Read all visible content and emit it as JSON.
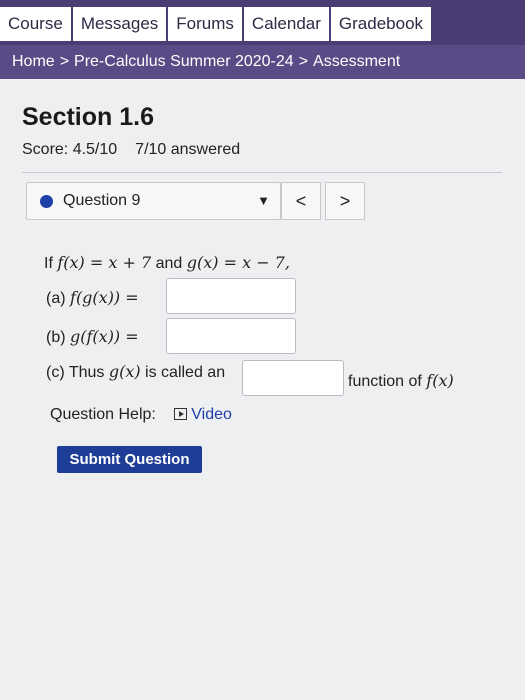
{
  "nav": {
    "tabs": [
      "Course",
      "Messages",
      "Forums",
      "Calendar",
      "Gradebook"
    ]
  },
  "breadcrumb": {
    "home": "Home",
    "separator": ">",
    "course": "Pre-Calculus Summer 2020-24",
    "current": "Assessment"
  },
  "assessment": {
    "section_title": "Section 1.6",
    "score": "Score: 4.5/10",
    "answered": "7/10 answered"
  },
  "question_nav": {
    "label": "Question 9",
    "caret": "▼",
    "prev": "<",
    "next": ">"
  },
  "question": {
    "prompt_if": "If",
    "f_def": "f(x) = x + 7",
    "and": "and",
    "g_def": "g(x) = x − 7,",
    "part_a": "(a)",
    "part_a_expr": "f(g(x)) =",
    "part_b": "(b)",
    "part_b_expr": "g(f(x)) =",
    "part_c_pre": "(c) Thus",
    "part_c_gx": "g(x)",
    "part_c_mid": "is called an",
    "part_c_post": "function of",
    "part_c_fx": "f(x)",
    "answer_a": "",
    "answer_b": "",
    "answer_c": ""
  },
  "help": {
    "label": "Question Help:",
    "video": "Video"
  },
  "actions": {
    "submit_label": "Submit Question"
  },
  "colors": {
    "nav_bg": "#4b3d73",
    "breadcrumb_bg": "#5a4a86",
    "accent_blue": "#1e3d96"
  }
}
